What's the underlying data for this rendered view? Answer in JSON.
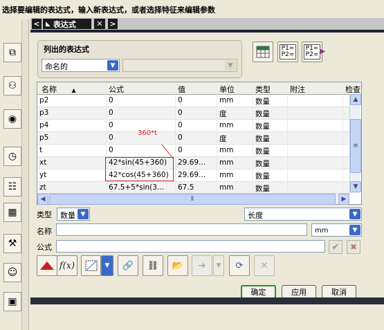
{
  "cue_line": "选择要编辑的表达式，输入新表达式，或者选择特征来编辑参数",
  "dialog": {
    "title": "表达式"
  },
  "list_group": {
    "title": "列出的表达式",
    "filter_value": "命名的",
    "sub_filter_value": ""
  },
  "columns": [
    "名称",
    "公式",
    "值",
    "单位",
    "类型",
    "附注",
    "检查"
  ],
  "rows": [
    [
      "p2",
      "0",
      "0",
      "mm",
      "数量",
      ""
    ],
    [
      "p3",
      "0",
      "0",
      "度",
      "数量",
      ""
    ],
    [
      "p4",
      "0",
      "0",
      "mm",
      "数量",
      ""
    ],
    [
      "p5",
      "0",
      "0",
      "度",
      "数量",
      ""
    ],
    [
      "t",
      "0",
      "0",
      "mm",
      "数量",
      ""
    ],
    [
      "xt",
      "42*sin(45+360)",
      "29.69...",
      "mm",
      "数量",
      ""
    ],
    [
      "yt",
      "42*cos(45+360)",
      "29.69...",
      "mm",
      "数量",
      ""
    ],
    [
      "zt",
      "67.5+5*sin(3...",
      "67.5",
      "mm",
      "数量",
      ""
    ]
  ],
  "annotation": "360*t",
  "type_label": "类型",
  "type_value": "数量",
  "dimension_value": "长度",
  "name_label": "名称",
  "name_value": "",
  "unit_value": "mm",
  "formula_label": "公式",
  "formula_value": "",
  "buttons": {
    "ok": "确定",
    "apply": "应用",
    "cancel": "取消"
  },
  "icons": {
    "sort": "sort-ascending-icon",
    "spreadsheet": "spreadsheet-icon",
    "export": "export-expressions-icon",
    "import": "import-expressions-icon",
    "function": "function-icon"
  },
  "fx_text": "f(x)",
  "colors": {
    "highlight_box": "#cc2222",
    "ok_button_border": "#2f8a2f",
    "dropdown_blue": "#3a69c8"
  }
}
